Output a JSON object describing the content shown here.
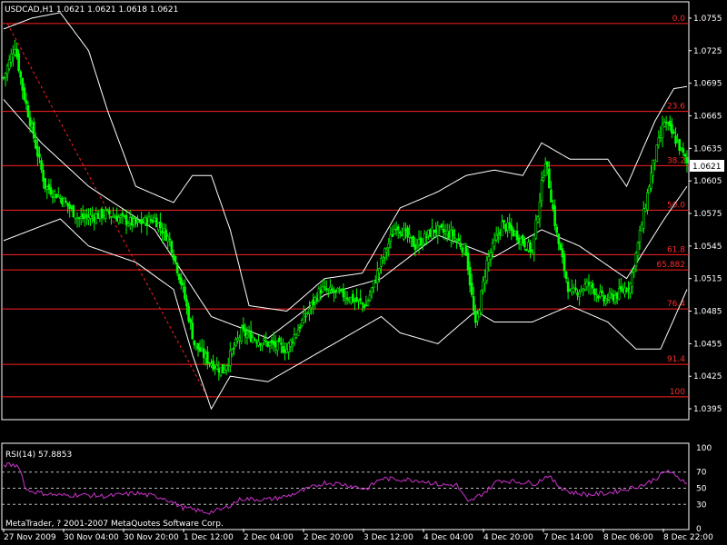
{
  "header": {
    "title": "USDCAD,H1  1.0621 1.0621 1.0618 1.0621",
    "current_price": "1.0621",
    "copyright": "MetaTrader, ? 2001-2007 MetaQuotes Software Corp."
  },
  "colors": {
    "background": "#000000",
    "bull_candle": "#00ff00",
    "bear_candle": "#00ff00",
    "bands": "#ffffff",
    "fibo": "#ff2020",
    "rsi_line": "#cc33cc",
    "grid_text": "#ffffff"
  },
  "chart_data": [
    {
      "type": "candlestick",
      "name": "USDCAD,H1",
      "ylim": [
        1.0385,
        1.077
      ],
      "y_ticks": [
        "1.0755",
        "1.0725",
        "1.0695",
        "1.0665",
        "1.0635",
        "1.0605",
        "1.0575",
        "1.0545",
        "1.0515",
        "1.0485",
        "1.0455",
        "1.0425",
        "1.0395"
      ],
      "x_tick_labels": [
        "27 Nov 2009",
        "30 Nov 04:00",
        "30 Nov 20:00",
        "1 Dec 12:00",
        "2 Dec 04:00",
        "2 Dec 20:00",
        "3 Dec 12:00",
        "4 Dec 04:00",
        "4 Dec 20:00",
        "7 Dec 14:00",
        "8 Dec 06:00",
        "8 Dec 22:00"
      ],
      "price_anchors": [
        [
          0,
          1.07
        ],
        [
          6,
          1.073
        ],
        [
          10,
          1.069
        ],
        [
          16,
          1.0645
        ],
        [
          22,
          1.06
        ],
        [
          30,
          1.059
        ],
        [
          40,
          1.057
        ],
        [
          55,
          1.0575
        ],
        [
          70,
          1.0565
        ],
        [
          80,
          1.057
        ],
        [
          88,
          1.055
        ],
        [
          95,
          1.0505
        ],
        [
          101,
          1.0455
        ],
        [
          108,
          1.044
        ],
        [
          116,
          1.043
        ],
        [
          126,
          1.0465
        ],
        [
          140,
          1.0455
        ],
        [
          150,
          1.045
        ],
        [
          158,
          1.0475
        ],
        [
          168,
          1.0505
        ],
        [
          180,
          1.05
        ],
        [
          192,
          1.049
        ],
        [
          200,
          1.053
        ],
        [
          208,
          1.0565
        ],
        [
          218,
          1.0545
        ],
        [
          228,
          1.056
        ],
        [
          238,
          1.0555
        ],
        [
          245,
          1.054
        ],
        [
          250,
          1.047
        ],
        [
          256,
          1.053
        ],
        [
          264,
          1.0565
        ],
        [
          272,
          1.0555
        ],
        [
          280,
          1.054
        ],
        [
          287,
          1.0625
        ],
        [
          293,
          1.0555
        ],
        [
          300,
          1.05
        ],
        [
          310,
          1.051
        ],
        [
          318,
          1.0495
        ],
        [
          325,
          1.05
        ],
        [
          332,
          1.051
        ],
        [
          338,
          1.0565
        ],
        [
          344,
          1.062
        ],
        [
          350,
          1.066
        ],
        [
          357,
          1.064
        ],
        [
          362,
          1.0621
        ]
      ],
      "bollinger": {
        "middle": [
          [
            0,
            1.068
          ],
          [
            20,
            1.064
          ],
          [
            45,
            1.06
          ],
          [
            80,
            1.056
          ],
          [
            110,
            1.048
          ],
          [
            140,
            1.046
          ],
          [
            170,
            1.05
          ],
          [
            200,
            1.0515
          ],
          [
            230,
            1.0555
          ],
          [
            260,
            1.0535
          ],
          [
            285,
            1.056
          ],
          [
            305,
            1.0545
          ],
          [
            330,
            1.0515
          ],
          [
            350,
            1.057
          ],
          [
            362,
            1.06
          ]
        ],
        "upper": [
          [
            0,
            1.0745
          ],
          [
            15,
            1.0755
          ],
          [
            30,
            1.076
          ],
          [
            45,
            1.0725
          ],
          [
            55,
            1.067
          ],
          [
            70,
            1.06
          ],
          [
            90,
            1.0585
          ],
          [
            100,
            1.061
          ],
          [
            110,
            1.061
          ],
          [
            120,
            1.056
          ],
          [
            130,
            1.049
          ],
          [
            150,
            1.0485
          ],
          [
            170,
            1.0515
          ],
          [
            190,
            1.052
          ],
          [
            210,
            1.058
          ],
          [
            230,
            1.0595
          ],
          [
            245,
            1.061
          ],
          [
            260,
            1.0615
          ],
          [
            275,
            1.061
          ],
          [
            285,
            1.064
          ],
          [
            300,
            1.0625
          ],
          [
            320,
            1.0625
          ],
          [
            330,
            1.06
          ],
          [
            345,
            1.066
          ],
          [
            355,
            1.069
          ],
          [
            362,
            1.0692
          ]
        ],
        "lower": [
          [
            0,
            1.055
          ],
          [
            15,
            1.056
          ],
          [
            30,
            1.057
          ],
          [
            45,
            1.0545
          ],
          [
            70,
            1.053
          ],
          [
            90,
            1.0505
          ],
          [
            100,
            1.0445
          ],
          [
            110,
            1.0395
          ],
          [
            120,
            1.0425
          ],
          [
            140,
            1.042
          ],
          [
            160,
            1.044
          ],
          [
            180,
            1.046
          ],
          [
            200,
            1.048
          ],
          [
            210,
            1.0465
          ],
          [
            230,
            1.0455
          ],
          [
            250,
            1.0485
          ],
          [
            260,
            1.0475
          ],
          [
            280,
            1.0475
          ],
          [
            300,
            1.049
          ],
          [
            320,
            1.0475
          ],
          [
            335,
            1.045
          ],
          [
            348,
            1.045
          ],
          [
            362,
            1.0505
          ]
        ]
      }
    },
    {
      "type": "line",
      "name": "RSI(14)",
      "title": "RSI(14) 57.8853",
      "ylim": [
        0,
        100
      ],
      "y_ticks": [
        "100",
        "70",
        "50",
        "30",
        "0"
      ],
      "levels": [
        70,
        50,
        30
      ],
      "values_anchors": [
        [
          0,
          79
        ],
        [
          8,
          78
        ],
        [
          12,
          48
        ],
        [
          20,
          44
        ],
        [
          30,
          41
        ],
        [
          40,
          42
        ],
        [
          55,
          40
        ],
        [
          70,
          44
        ],
        [
          85,
          38
        ],
        [
          95,
          26
        ],
        [
          108,
          20
        ],
        [
          116,
          24
        ],
        [
          126,
          37
        ],
        [
          140,
          36
        ],
        [
          150,
          40
        ],
        [
          160,
          48
        ],
        [
          170,
          57
        ],
        [
          180,
          55
        ],
        [
          192,
          49
        ],
        [
          200,
          62
        ],
        [
          210,
          61
        ],
        [
          220,
          60
        ],
        [
          232,
          54
        ],
        [
          240,
          54
        ],
        [
          246,
          32
        ],
        [
          256,
          47
        ],
        [
          262,
          60
        ],
        [
          272,
          58
        ],
        [
          282,
          56
        ],
        [
          288,
          66
        ],
        [
          294,
          53
        ],
        [
          300,
          45
        ],
        [
          310,
          42
        ],
        [
          320,
          44
        ],
        [
          332,
          50
        ],
        [
          340,
          55
        ],
        [
          346,
          63
        ],
        [
          352,
          72
        ],
        [
          356,
          64
        ],
        [
          362,
          58
        ]
      ]
    }
  ],
  "fibonacci": {
    "levels": [
      {
        "label": "0.0",
        "price": 1.075
      },
      {
        "label": "23.6",
        "price": 1.0669
      },
      {
        "label": "38.2",
        "price": 1.0619
      },
      {
        "label": "50.0",
        "price": 1.0578
      },
      {
        "label": "61.8",
        "price": 1.0537
      },
      {
        "label": "65.882",
        "price": 1.0523
      },
      {
        "label": "76.4",
        "price": 1.0487
      },
      {
        "label": "91.4",
        "price": 1.0436
      },
      {
        "label": "100",
        "price": 1.0406
      }
    ]
  }
}
